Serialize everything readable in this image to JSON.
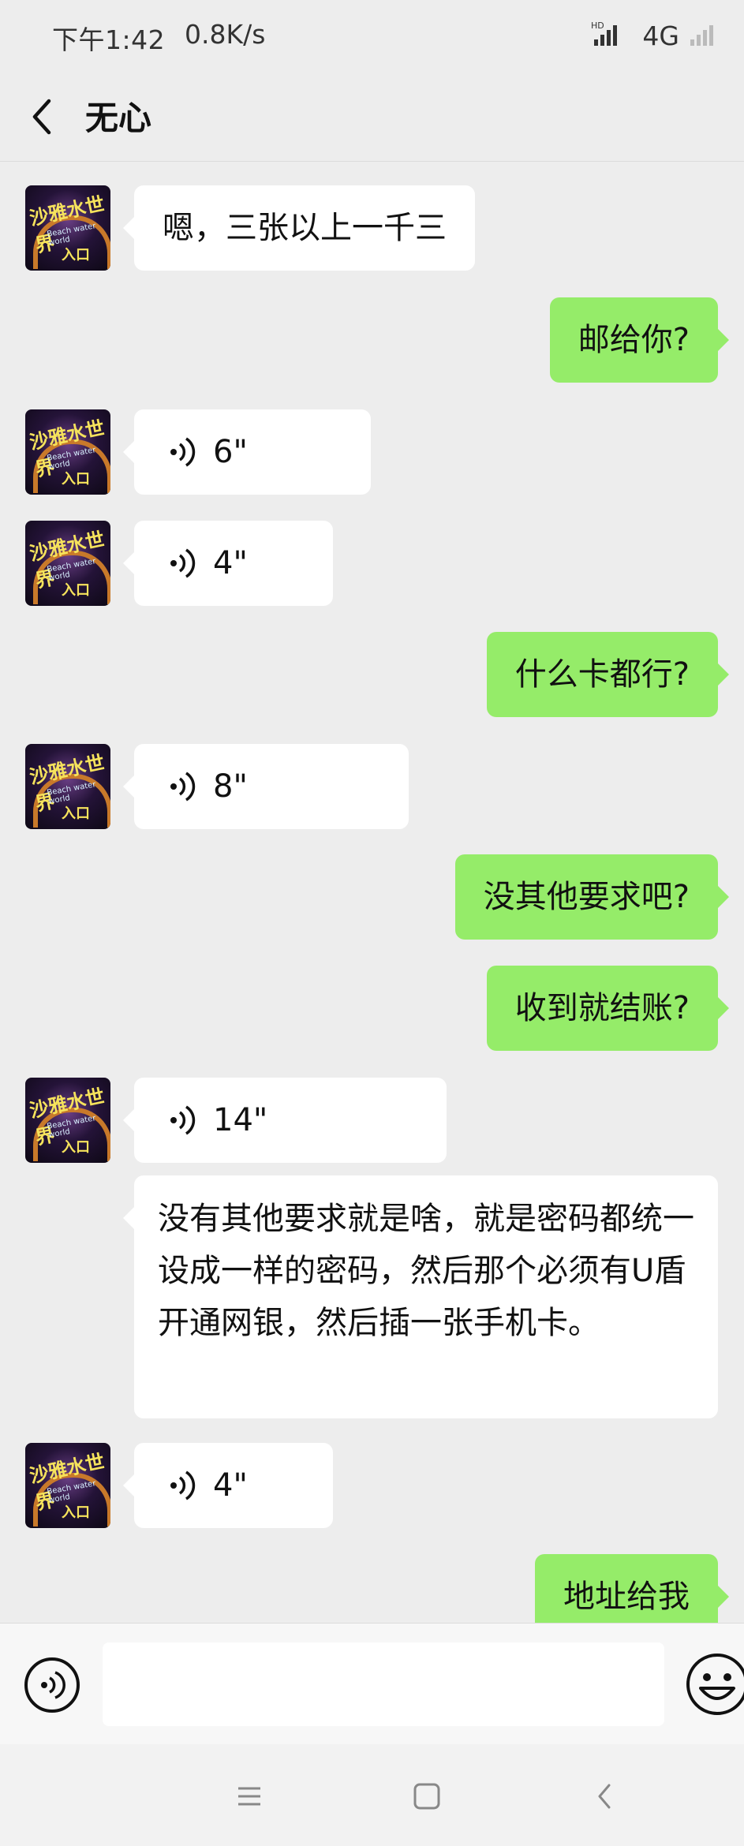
{
  "status_bar": {
    "time": "下午1:42",
    "speed": "0.8K/s",
    "network": "4G",
    "hd": "HD"
  },
  "header": {
    "title": "无心"
  },
  "avatar": {
    "name_text": "沙雅水世界",
    "subtext": "Beach water world",
    "entrance_text": "入口"
  },
  "messages": [
    {
      "side": "left",
      "type": "text",
      "text": "嗯，三张以上一千三"
    },
    {
      "side": "right",
      "type": "text",
      "text": "邮给你?"
    },
    {
      "side": "left",
      "type": "voice",
      "duration": "6\""
    },
    {
      "side": "left",
      "type": "voice",
      "duration": "4\""
    },
    {
      "side": "right",
      "type": "text",
      "text": "什么卡都行?"
    },
    {
      "side": "left",
      "type": "voice",
      "duration": "8\""
    },
    {
      "side": "right",
      "type": "text",
      "text": "没其他要求吧?"
    },
    {
      "side": "right",
      "type": "text",
      "text": "收到就结账?"
    },
    {
      "side": "left",
      "type": "voice",
      "duration": "14\""
    },
    {
      "side": "left",
      "type": "text",
      "text": "没有其他要求就是啥，就是密码都统一设成一样的密码，然后那个必须有U盾开通网银，然后插一张手机卡。"
    },
    {
      "side": "left",
      "type": "voice",
      "duration": "4\""
    },
    {
      "side": "right",
      "type": "text",
      "text": "地址给我"
    }
  ],
  "input_bar": {
    "placeholder": ""
  },
  "icons": {
    "back": "back-arrow-icon",
    "voice": "voice-wave-icon",
    "emoji": "smiley-icon",
    "nav_menu": "menu-icon",
    "nav_home": "home-icon",
    "nav_back": "back-icon"
  },
  "colors": {
    "bg": "#ededed",
    "bubble_self": "#95ec69",
    "bubble_other": "#ffffff"
  }
}
